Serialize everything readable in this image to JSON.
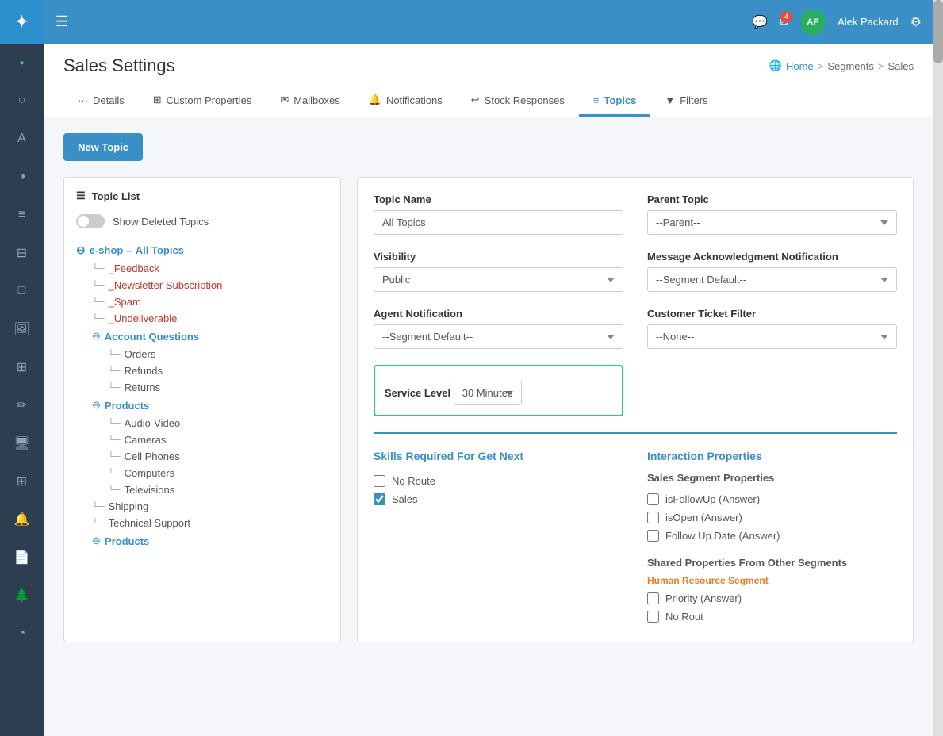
{
  "topbar": {
    "menu_icon": "☰",
    "chat_icon": "💬",
    "mail_icon": "✉",
    "mail_badge": "4",
    "user_initials": "AP",
    "user_name": "Alek Packard",
    "settings_icon": "⚙"
  },
  "breadcrumb": {
    "home": "Home",
    "seg": "Segments",
    "sales": "Sales"
  },
  "page_title": "Sales Settings",
  "tabs": [
    {
      "label": "Details",
      "icon": "···",
      "active": false
    },
    {
      "label": "Custom Properties",
      "icon": "⊞",
      "active": false
    },
    {
      "label": "Mailboxes",
      "icon": "✉",
      "active": false
    },
    {
      "label": "Notifications",
      "icon": "🔔",
      "active": false
    },
    {
      "label": "Stock Responses",
      "icon": "↩",
      "active": false
    },
    {
      "label": "Topics",
      "icon": "≡",
      "active": true
    },
    {
      "label": "Filters",
      "icon": "▼",
      "active": false
    }
  ],
  "new_topic_btn": "New Topic",
  "topic_list": {
    "title": "Topic List",
    "show_deleted_label": "Show Deleted Topics",
    "root_item": "e-shop -- All Topics",
    "items": [
      {
        "label": "_Feedback",
        "level": "child"
      },
      {
        "label": "_Newsletter Subscription",
        "level": "child"
      },
      {
        "label": "_Spam",
        "level": "child"
      },
      {
        "label": "_Undeliverable",
        "level": "child"
      },
      {
        "label": "Account Questions",
        "level": "section-root"
      },
      {
        "label": "Orders",
        "level": "child-sub"
      },
      {
        "label": "Refunds",
        "level": "child-sub"
      },
      {
        "label": "Returns",
        "level": "child-sub"
      },
      {
        "label": "Products",
        "level": "section-root"
      },
      {
        "label": "Audio-Video",
        "level": "child-sub"
      },
      {
        "label": "Cameras",
        "level": "child-sub"
      },
      {
        "label": "Cell Phones",
        "level": "child-sub"
      },
      {
        "label": "Computers",
        "level": "child-sub"
      },
      {
        "label": "Televisions",
        "level": "child-sub"
      },
      {
        "label": "Shipping",
        "level": "section"
      },
      {
        "label": "Technical Support",
        "level": "section"
      },
      {
        "label": "Products",
        "level": "section-root2"
      }
    ]
  },
  "form": {
    "topic_name_label": "Topic Name",
    "topic_name_value": "All Topics",
    "parent_topic_label": "Parent Topic",
    "parent_topic_value": "--Parent--",
    "visibility_label": "Visibility",
    "visibility_value": "Public",
    "msg_ack_label": "Message Acknowledgment Notification",
    "msg_ack_value": "--Segment Default--",
    "agent_notif_label": "Agent Notification",
    "agent_notif_value": "--Segment Default--",
    "customer_filter_label": "Customer Ticket Filter",
    "customer_filter_value": "--None--",
    "service_level_label": "Service Level",
    "service_level_value": "30 Minutes"
  },
  "skills_section": {
    "title": "Skills Required For Get Next",
    "items": [
      {
        "label": "No Route",
        "checked": false
      },
      {
        "label": "Sales",
        "checked": true
      }
    ]
  },
  "interaction_section": {
    "title": "Interaction Properties",
    "sales_segment_label": "Sales Segment Properties",
    "properties": [
      {
        "label": "isFollowUp (Answer)",
        "checked": false
      },
      {
        "label": "isOpen (Answer)",
        "checked": false
      },
      {
        "label": "Follow Up Date (Answer)",
        "checked": false
      }
    ],
    "shared_title": "Shared Properties From Other Segments",
    "human_resource_label": "Human Resource Segment",
    "human_resource_props": [
      {
        "label": "Priority (Answer)",
        "checked": false
      },
      {
        "label": "No Rout",
        "checked": false
      }
    ]
  }
}
